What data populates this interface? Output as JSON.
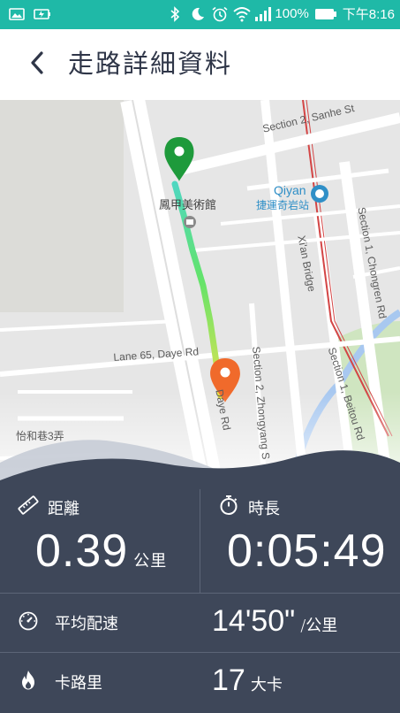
{
  "status_bar": {
    "battery_percent": "100%",
    "time": "下午8:16",
    "icons": [
      "image-icon",
      "battery-saver-icon",
      "bluetooth-icon",
      "moon-icon",
      "alarm-icon",
      "wifi-icon",
      "signal-icon",
      "battery-icon"
    ],
    "color": "#1fb9a7"
  },
  "header": {
    "title": "走路詳細資料",
    "back_icon": "chevron-left-icon"
  },
  "map": {
    "labels": {
      "sanhe_st": "Section 2, Sanhe St",
      "museum": "鳳甲美術館",
      "qiyan": "Qiyan",
      "qiyan_station": "捷運奇岩站",
      "xian_bridge": "Xi'an Bridge",
      "chongren_rd": "Section 1, Chongren Rd",
      "lane65": "Lane 65, Daye Rd",
      "daye_rd": "Daye Rd",
      "zhongyang": "Section 2, Zhongyang S",
      "beitou_rd": "Section 1, Beitou Rd",
      "yihe_lane": "怡和巷3弄"
    },
    "start_pin_color": "#1e9a3b",
    "end_pin_color": "#f06a2b"
  },
  "stats": {
    "distance": {
      "label": "距離",
      "value": "0.39",
      "unit": "公里",
      "icon": "ruler-icon"
    },
    "duration": {
      "label": "時長",
      "value": "0:05:49",
      "icon": "stopwatch-icon"
    },
    "pace": {
      "label": "平均配速",
      "value": "14'50\"",
      "unit": "/公里",
      "icon": "speedometer-icon"
    },
    "calories": {
      "label": "卡路里",
      "value": "17",
      "unit": "大卡",
      "icon": "flame-icon"
    }
  }
}
